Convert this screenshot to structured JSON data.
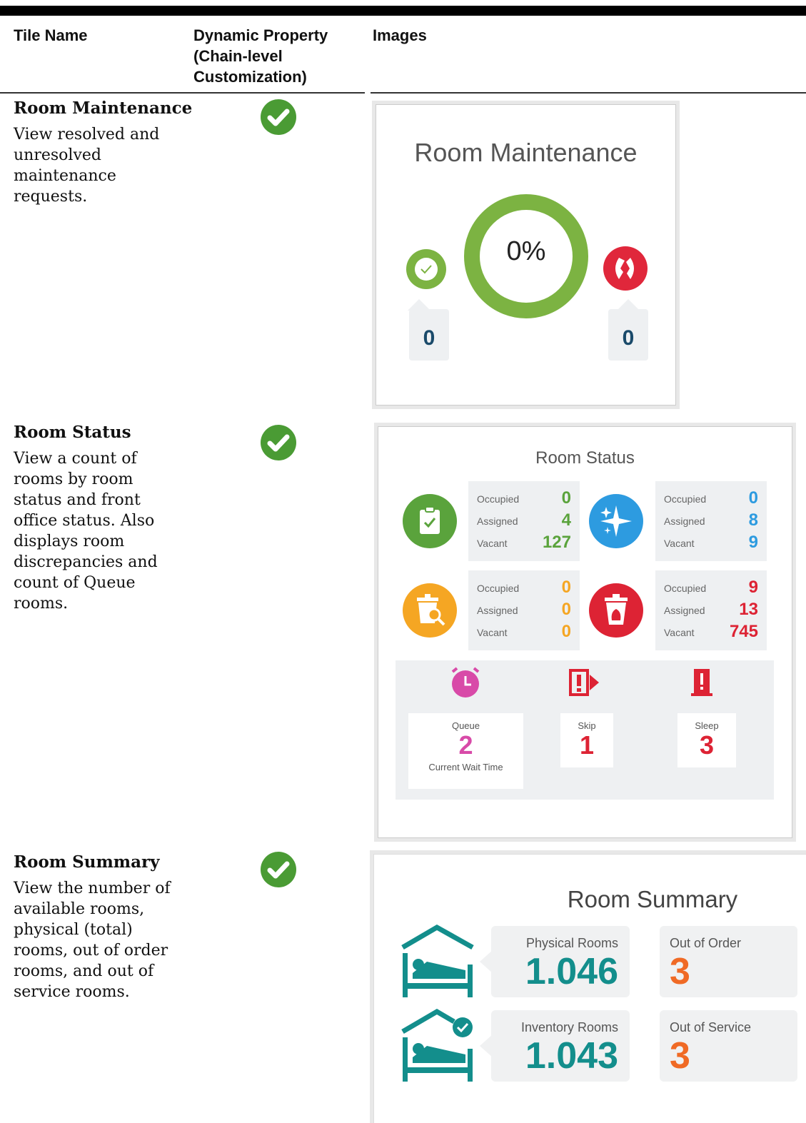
{
  "headers": {
    "col1": "Tile Name",
    "col2_l1": "Dynamic Property",
    "col2_l2": "(Chain-level",
    "col2_l3": "Customization)",
    "col3": "Images"
  },
  "rows": [
    {
      "name": "Room Maintenance",
      "desc": [
        "View resolved and",
        "unresolved",
        "maintenance",
        "requests."
      ]
    },
    {
      "name": "Room Status",
      "desc": [
        "View a count of",
        "rooms by room",
        "status and front",
        "office status. Also",
        "displays room",
        "discrepancies and",
        "count of Queue",
        "rooms."
      ]
    },
    {
      "name": "Room Summary",
      "desc": [
        "View the number of",
        "available rooms,",
        "physical (total)",
        "rooms, out of order",
        "rooms, and out of",
        "service rooms."
      ]
    }
  ],
  "maintenance": {
    "title": "Room Maintenance",
    "percent": "0%",
    "resolved": "0",
    "unresolved": "0",
    "colors": {
      "green": "#7cb342",
      "red": "#e0273b"
    }
  },
  "status": {
    "title": "Room Status",
    "labels": {
      "occupied": "Occupied",
      "assigned": "Assigned",
      "vacant": "Vacant"
    },
    "panels": [
      {
        "icon": "clipboard-check-icon",
        "color": "#5aa33c",
        "occupied": "0",
        "assigned": "4",
        "vacant": "127"
      },
      {
        "icon": "sparkle-icon",
        "color": "#2d9be0",
        "occupied": "0",
        "assigned": "8",
        "vacant": "9"
      },
      {
        "icon": "trash-search-icon",
        "color": "#f5a623",
        "occupied": "0",
        "assigned": "0",
        "vacant": "0"
      },
      {
        "icon": "trash-bag-icon",
        "color": "#dd2334",
        "occupied": "9",
        "assigned": "13",
        "vacant": "745"
      }
    ],
    "queue": {
      "label": "Queue",
      "value": "2",
      "sub": "Current Wait Time"
    },
    "skip": {
      "label": "Skip",
      "value": "1"
    },
    "sleep": {
      "label": "Sleep",
      "value": "3"
    }
  },
  "summary": {
    "title": "Room Summary",
    "physical": {
      "label": "Physical Rooms",
      "value": "1.046"
    },
    "inventory": {
      "label": "Inventory Rooms",
      "value": "1.043"
    },
    "out_of_order": {
      "label": "Out of Order",
      "value": "3"
    },
    "out_of_service": {
      "label": "Out of Service",
      "value": "3"
    },
    "colors": {
      "teal": "#138e8c",
      "orange": "#f06a25"
    }
  }
}
